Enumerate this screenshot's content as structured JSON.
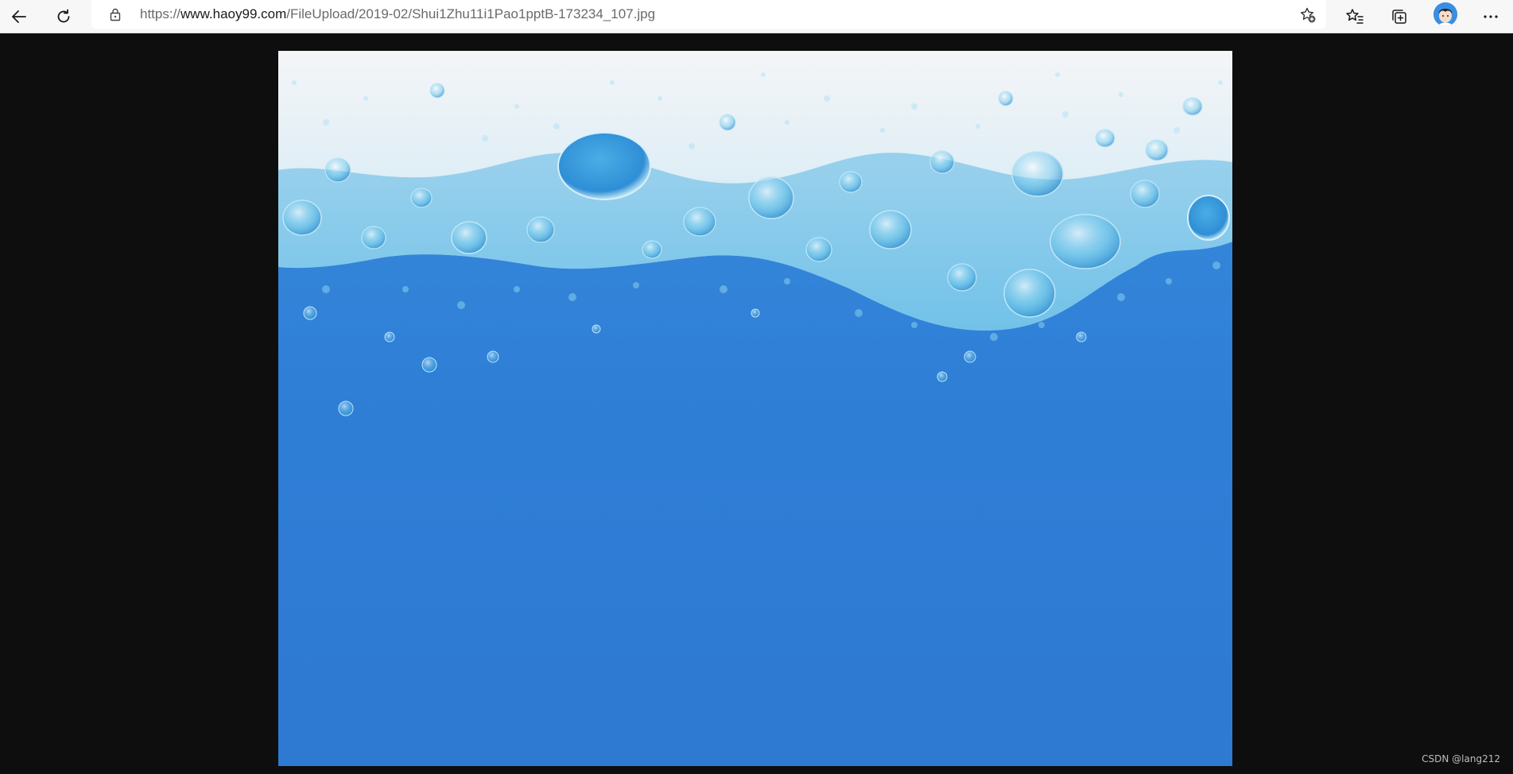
{
  "browser": {
    "url_scheme": "https://",
    "url_host": "www.haoy99.com",
    "url_path": "/FileUpload/2019-02/Shui1Zhu11i1Pao1pptB-173234_107.jpg",
    "icons": {
      "back": "back-arrow-icon",
      "refresh": "refresh-icon",
      "lock": "lock-icon",
      "add_favorite": "add-favorite-icon",
      "favorites": "favorites-icon",
      "collections": "collections-icon",
      "profile": "profile-avatar",
      "more": "more-options-icon"
    }
  },
  "image": {
    "subject": "blue water with foam bubbles",
    "colors": {
      "water": "#2e79d2",
      "foam_light": "#eef3f7",
      "bubble_blue": "#4fb3e0"
    }
  },
  "watermark": {
    "text": "CSDN @lang212"
  },
  "colors": {
    "toolbar": "#f7f7f7",
    "viewer_background": "#0e0e0e"
  }
}
